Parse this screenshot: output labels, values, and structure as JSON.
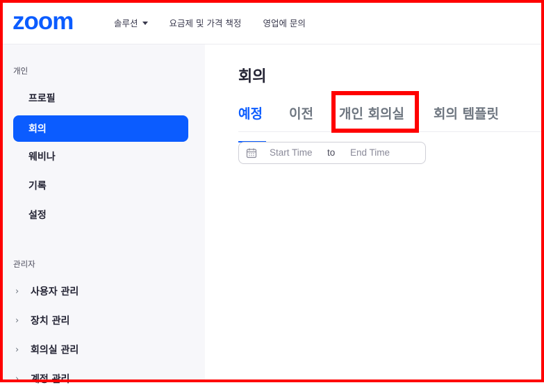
{
  "header": {
    "logo": "zoom",
    "nav": [
      {
        "label": "솔루션",
        "has_dropdown": true
      },
      {
        "label": "요금제 및 가격 책정"
      },
      {
        "label": "영업에 문의"
      }
    ]
  },
  "sidebar": {
    "personal_heading": "개인",
    "personal_items": [
      {
        "label": "프로필"
      },
      {
        "label": "회의",
        "active": true
      },
      {
        "label": "웨비나"
      },
      {
        "label": "기록"
      },
      {
        "label": "설정"
      }
    ],
    "admin_heading": "관리자",
    "admin_items": [
      {
        "label": "사용자 관리"
      },
      {
        "label": "장치 관리"
      },
      {
        "label": "회의실 관리"
      },
      {
        "label": "계정 관리"
      }
    ]
  },
  "main": {
    "title": "회의",
    "tabs": [
      {
        "label": "예정",
        "active": true
      },
      {
        "label": "이전"
      },
      {
        "label": "개인 회의실",
        "highlighted": true
      },
      {
        "label": "회의 템플릿"
      }
    ],
    "date_range": {
      "start_placeholder": "Start Time",
      "separator": "to",
      "end_placeholder": "End Time"
    }
  },
  "colors": {
    "brand": "#0b5cff",
    "highlight": "#ff0000",
    "sidebar_bg": "#f7f7fa"
  }
}
